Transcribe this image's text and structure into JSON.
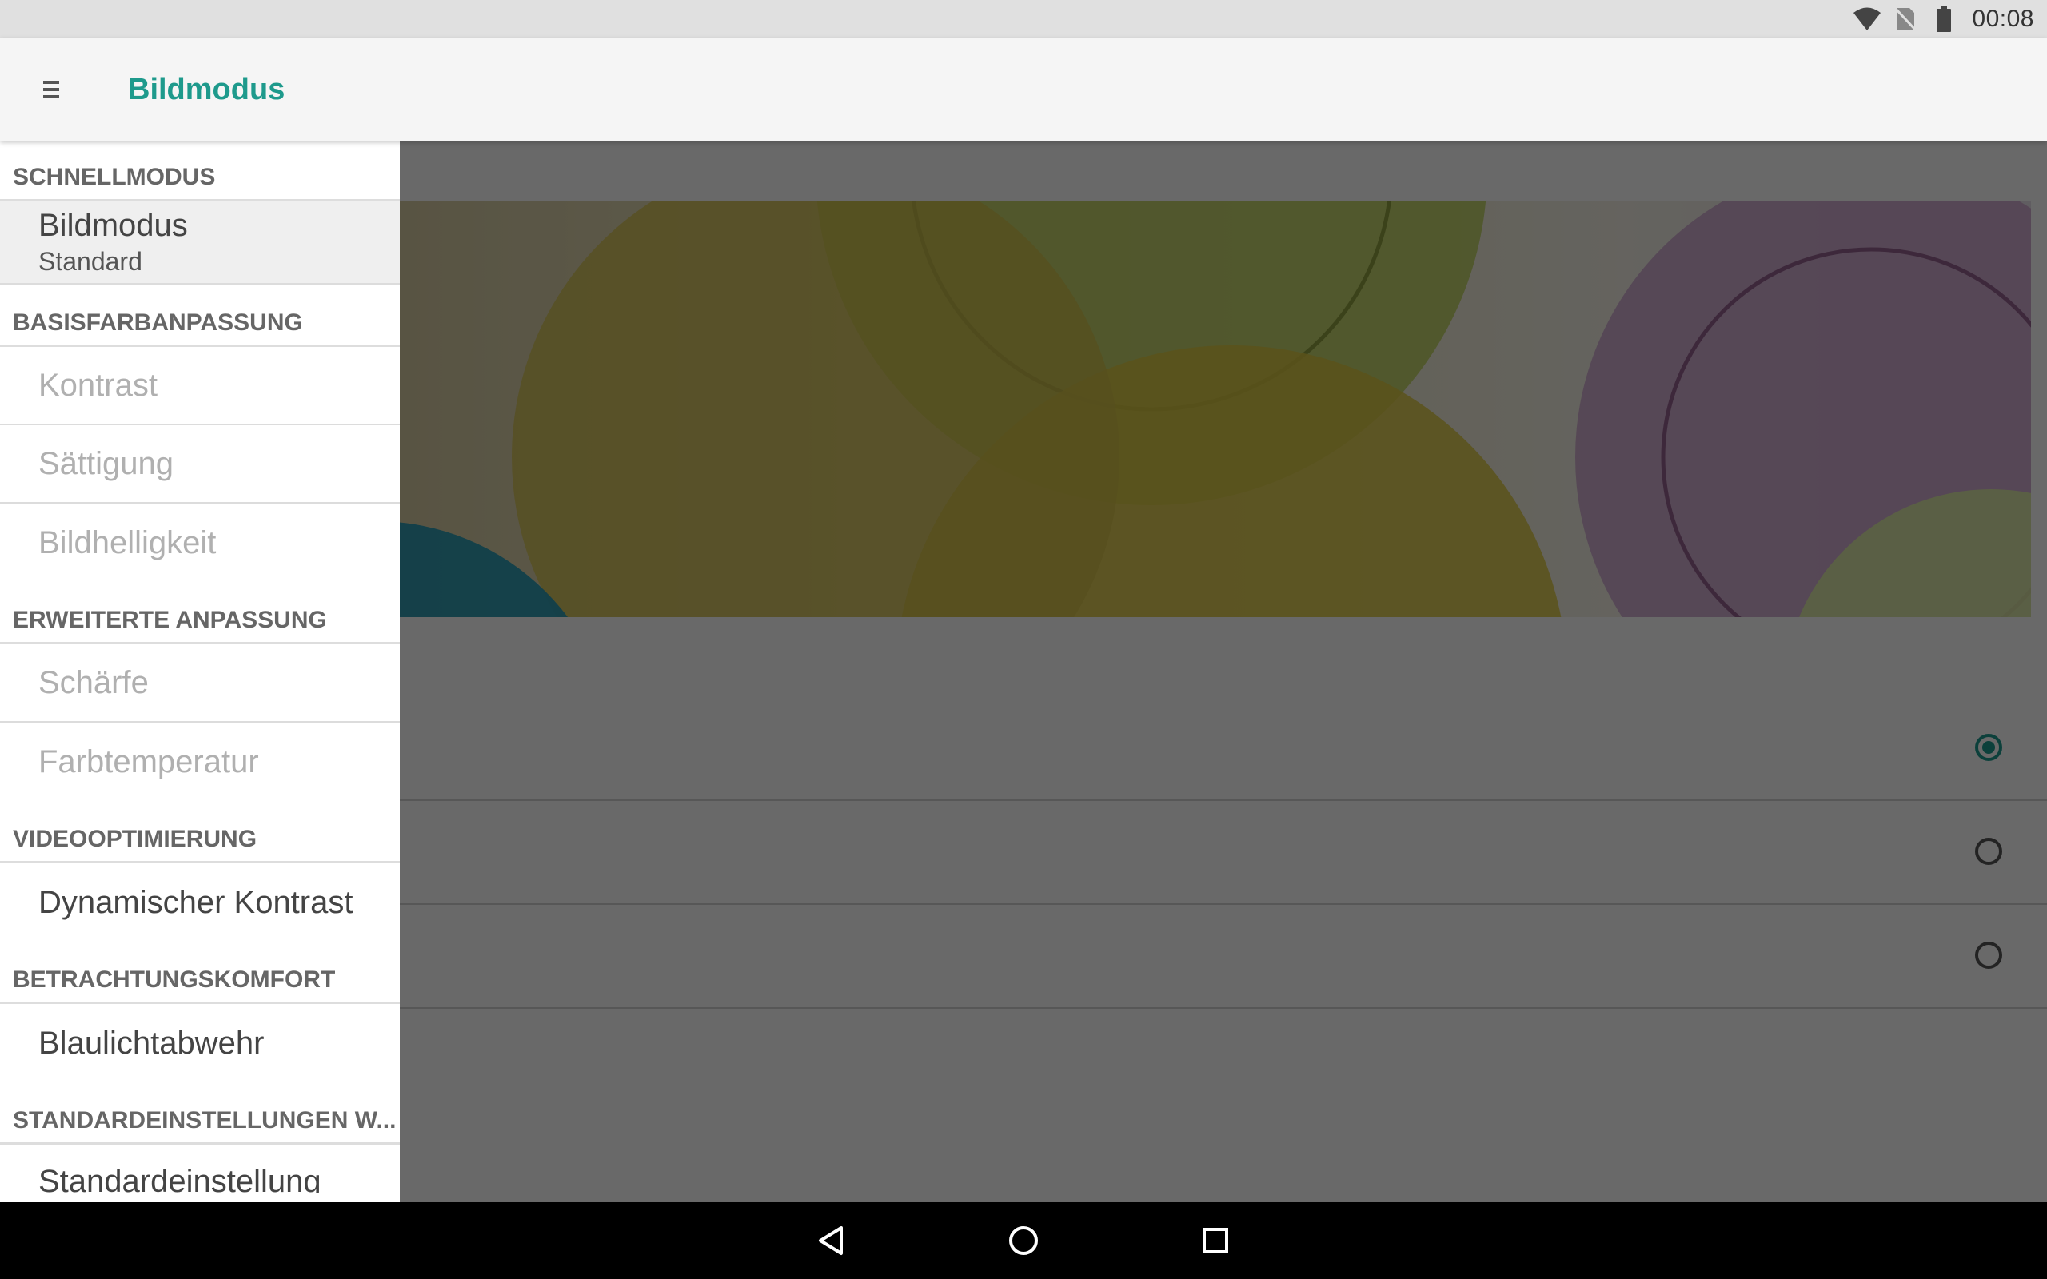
{
  "status_bar": {
    "time": "00:08",
    "icons": [
      "wifi-icon",
      "no-sim-icon",
      "battery-icon"
    ]
  },
  "app_bar": {
    "menu_icon": "hamburger-menu-icon",
    "title": "Bildmodus",
    "title_color": "#1e9a8c"
  },
  "drawer": {
    "sections": [
      {
        "header": "SCHNELLMODUS",
        "items": [
          {
            "label": "Bildmodus",
            "sub": "Standard",
            "selected": true,
            "enabled": true
          }
        ]
      },
      {
        "header": "BASISFARBANPASSUNG",
        "items": [
          {
            "label": "Kontrast",
            "enabled": false
          },
          {
            "label": "Sättigung",
            "enabled": false
          },
          {
            "label": "Bildhelligkeit",
            "enabled": false
          }
        ]
      },
      {
        "header": "ERWEITERTE ANPASSUNG",
        "items": [
          {
            "label": "Schärfe",
            "enabled": false
          },
          {
            "label": "Farbtemperatur",
            "enabled": false
          }
        ]
      },
      {
        "header": "VIDEOOPTIMIERUNG",
        "items": [
          {
            "label": "Dynamischer Kontrast",
            "enabled": true
          }
        ]
      },
      {
        "header": "BETRACHTUNGSKOMFORT",
        "items": [
          {
            "label": "Blaulichtabwehr",
            "enabled": true
          }
        ]
      },
      {
        "header": "STANDARDEINSTELLUNGEN W...",
        "items": [
          {
            "label": "Standardeinstellung",
            "enabled": true
          }
        ]
      }
    ]
  },
  "content": {
    "options": [
      {
        "checked": true
      },
      {
        "checked": false
      },
      {
        "checked": false
      }
    ]
  },
  "nav_bar": {
    "buttons": [
      "back-icon",
      "home-icon",
      "recents-icon"
    ]
  }
}
